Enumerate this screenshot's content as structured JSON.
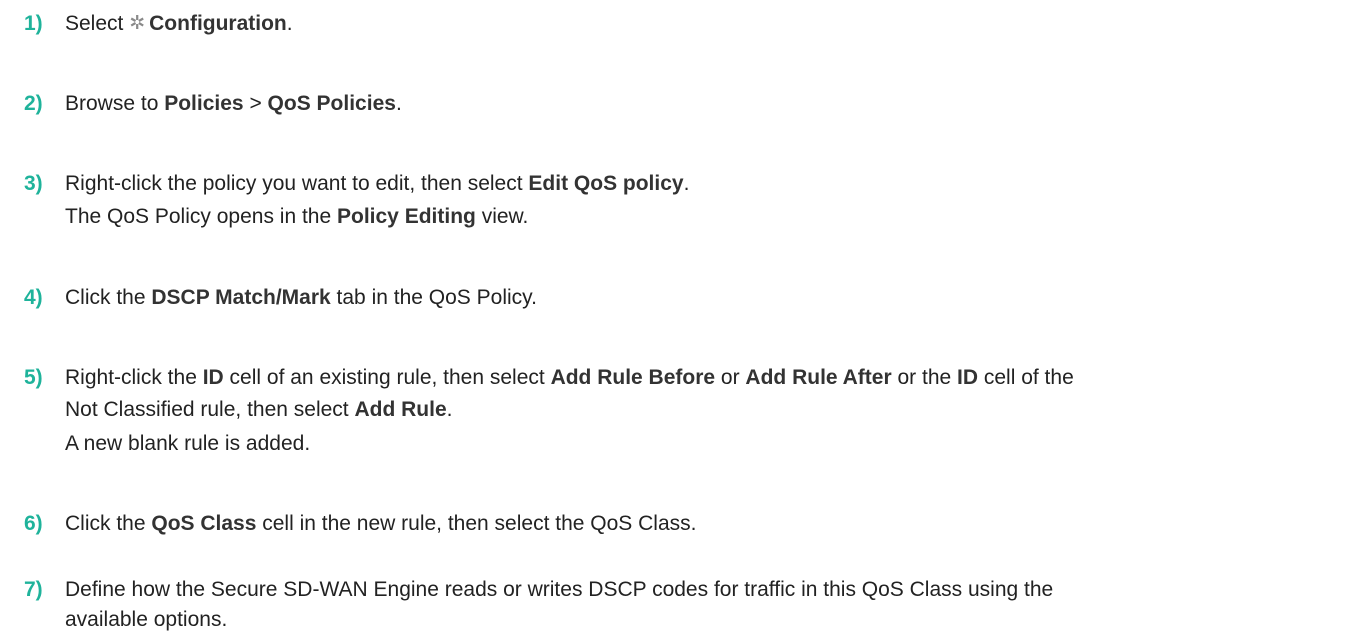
{
  "theme": {
    "step_number_color": "#1fb39b",
    "text_color": "#222222",
    "icon_color": "#8a8a8a"
  },
  "steps": [
    {
      "number": "1)",
      "text": {
        "a": "Select ",
        "icon": "gear-icon",
        "b": "Configuration",
        "c": "."
      }
    },
    {
      "number": "2)",
      "text": {
        "a": "Browse to ",
        "b": "Policies",
        "c": " > ",
        "d": "QoS Policies",
        "e": "."
      }
    },
    {
      "number": "3)",
      "text": {
        "a": "Right-click the policy you want to edit, then select ",
        "b": "Edit QoS policy",
        "c": "."
      },
      "result": {
        "a": "The QoS Policy opens in the ",
        "b": "Policy Editing",
        "c": " view."
      }
    },
    {
      "number": "4)",
      "text": {
        "a": "Click the ",
        "b": "DSCP Match/Mark",
        "c": " tab in the QoS Policy."
      }
    },
    {
      "number": "5)",
      "text": {
        "a": "Right-click the ",
        "b": "ID",
        "c": " cell of an existing rule, then select ",
        "d": "Add Rule Before",
        "e": " or ",
        "f": "Add Rule After",
        "g": " or the ",
        "h": "ID",
        "i": " cell of the",
        "j": "Not Classified rule, then select ",
        "k": "Add Rule",
        "l": "."
      },
      "result": "A new blank rule is added."
    },
    {
      "number": "6)",
      "text": {
        "a": "Click the ",
        "b": "QoS Class",
        "c": " cell in the new rule, then select the QoS Class."
      }
    },
    {
      "number": "7)",
      "text": {
        "a": "Define how the Secure SD-WAN Engine reads or writes DSCP codes for traffic in this QoS Class using the",
        "b": "available options."
      }
    }
  ]
}
